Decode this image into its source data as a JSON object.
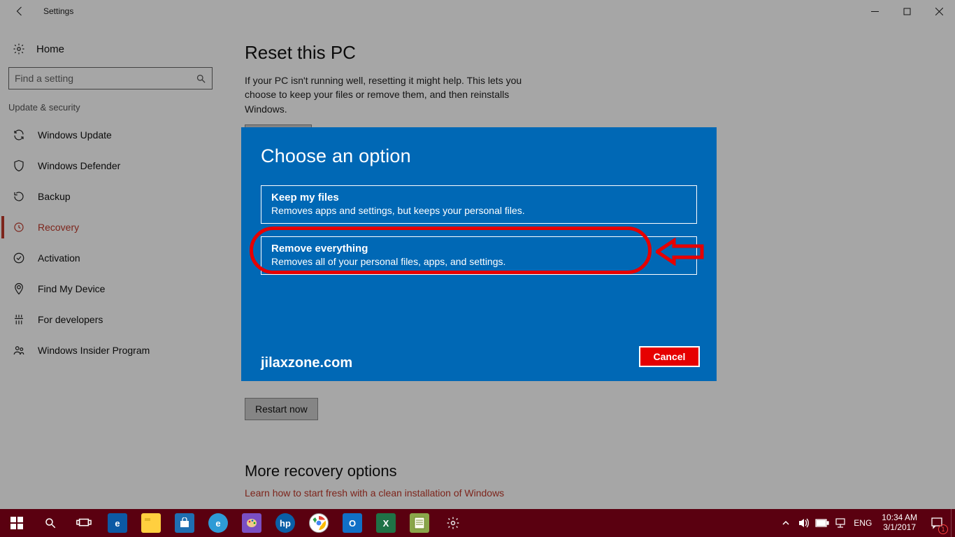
{
  "window": {
    "title": "Settings",
    "home_label": "Home",
    "search_placeholder": "Find a setting",
    "group_label": "Update & security"
  },
  "sidebar": {
    "items": [
      {
        "label": "Windows Update"
      },
      {
        "label": "Windows Defender"
      },
      {
        "label": "Backup"
      },
      {
        "label": "Recovery"
      },
      {
        "label": "Activation"
      },
      {
        "label": "Find My Device"
      },
      {
        "label": "For developers"
      },
      {
        "label": "Windows Insider Program"
      }
    ]
  },
  "main": {
    "reset_title": "Reset this PC",
    "reset_desc": "If your PC isn't running well, resetting it might help. This lets you choose to keep your files or remove them, and then reinstalls Windows.",
    "restart_label": "Restart now",
    "more_title": "More recovery options",
    "more_link": "Learn how to start fresh with a clean installation of Windows"
  },
  "modal": {
    "title": "Choose an option",
    "keep_title": "Keep my files",
    "keep_desc": "Removes apps and settings, but keeps your personal files.",
    "remove_title": "Remove everything",
    "remove_desc": "Removes all of your personal files, apps, and settings.",
    "cancel": "Cancel",
    "watermark": "jilaxzone.com"
  },
  "taskbar": {
    "lang": "ENG",
    "time": "10:34 AM",
    "date": "3/1/2017",
    "notif_count": "1"
  }
}
